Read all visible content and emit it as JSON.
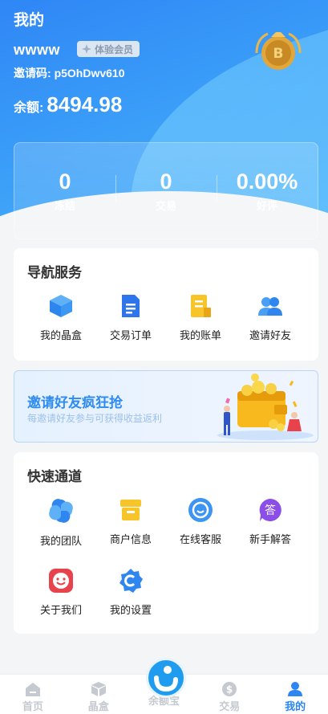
{
  "header": {
    "title": "我的",
    "username": "wwww",
    "vip_label": "体验会员",
    "invite_label": "邀请码:",
    "invite_code": "p5OhDwv610",
    "balance_label": "余额:",
    "balance_value": "8494.98"
  },
  "stats": [
    {
      "value": "0",
      "label": "冻结"
    },
    {
      "value": "0",
      "label": "交易"
    },
    {
      "value": "0.00%",
      "label": "好评"
    }
  ],
  "nav_services": {
    "title": "导航服务",
    "items": [
      {
        "label": "我的晶盒",
        "icon": "cube-icon"
      },
      {
        "label": "交易订单",
        "icon": "document-icon"
      },
      {
        "label": "我的账单",
        "icon": "bill-icon"
      },
      {
        "label": "邀请好友",
        "icon": "users-icon"
      }
    ]
  },
  "banner": {
    "headline": "邀请好友疯狂抢",
    "subtext": "每邀请好友参与可获得收益返利"
  },
  "quick_access": {
    "title": "快速通道",
    "items": [
      {
        "label": "我的团队",
        "icon": "team-icon"
      },
      {
        "label": "商户信息",
        "icon": "shop-icon"
      },
      {
        "label": "在线客服",
        "icon": "chat-icon"
      },
      {
        "label": "新手解答",
        "icon": "answer-icon"
      },
      {
        "label": "关于我们",
        "icon": "smile-icon"
      },
      {
        "label": "我的设置",
        "icon": "settings-icon"
      }
    ],
    "answer_glyph": "答"
  },
  "tabbar": {
    "items": [
      {
        "label": "首页",
        "icon": "home-icon"
      },
      {
        "label": "晶盒",
        "icon": "box-icon"
      },
      {
        "label": "余额宝",
        "icon": "wallet-icon"
      },
      {
        "label": "交易",
        "icon": "dollar-icon"
      },
      {
        "label": "我的",
        "icon": "user-icon"
      }
    ],
    "active": "我的"
  },
  "colors": {
    "primary": "#2e86f2",
    "hero_start": "#2f86f6",
    "hero_end": "#4ab4fb",
    "tab_inactive": "#c5c9d0"
  }
}
